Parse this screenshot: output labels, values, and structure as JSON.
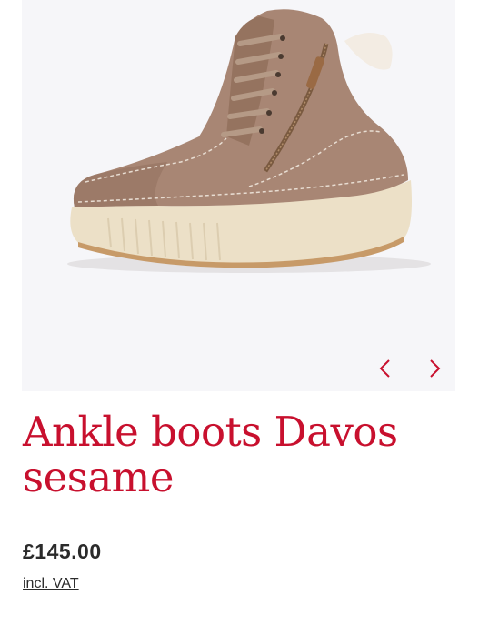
{
  "product": {
    "title": "Ankle boots Davos sesame",
    "price": "£145.00",
    "vat_label": "incl. VAT",
    "image_alt": "Ankle boots Davos sesame"
  },
  "gallery": {
    "prev_icon": "chevron-left-icon",
    "next_icon": "chevron-right-icon"
  },
  "colors": {
    "title": "#c8102e",
    "text": "#2b2b2b",
    "gallery_bg": "#f6f6f9",
    "suede": "#a88674",
    "sole": "#ece0c7"
  }
}
